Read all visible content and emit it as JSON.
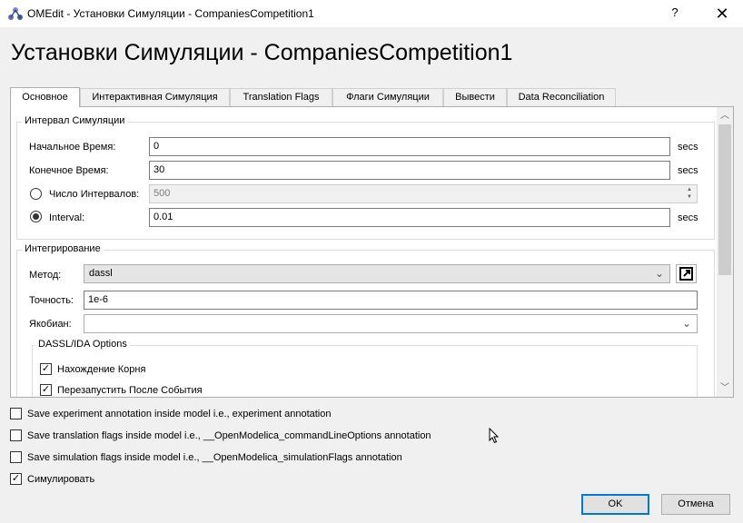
{
  "window": {
    "title": "OMEdit - Установки Симуляции - CompaniesCompetition1",
    "help": "?",
    "close": "✕"
  },
  "heading": "Установки Симуляции - CompaniesCompetition1",
  "tabs": [
    {
      "label": "Основное"
    },
    {
      "label": "Интерактивная Симуляция"
    },
    {
      "label": "Translation Flags"
    },
    {
      "label": "Флаги Симуляции"
    },
    {
      "label": "Вывести"
    },
    {
      "label": "Data Reconciliation"
    }
  ],
  "interval_group": {
    "title": "Интервал Симуляции",
    "start_label": "Начальное Время:",
    "start_value": "0",
    "stop_label": "Конечное Время:",
    "stop_value": "30",
    "num_intervals_label": "Число Интервалов:",
    "num_intervals_value": "500",
    "interval_label": "Interval:",
    "interval_value": "0.01",
    "unit": "secs"
  },
  "integration_group": {
    "title": "Интегрирование",
    "method_label": "Метод:",
    "method_value": "dassl",
    "tolerance_label": "Точность:",
    "tolerance_value": "1e-6",
    "jacobian_label": "Якобиан:",
    "jacobian_value": ""
  },
  "dassl_group": {
    "title": "DASSL/IDA Options",
    "root_finding": "Нахождение Корня",
    "restart_after_event": "Перезапустить После События"
  },
  "footer": {
    "save_experiment": "Save experiment annotation inside model i.e., experiment annotation",
    "save_translation": "Save translation flags inside model i.e., __OpenModelica_commandLineOptions annotation",
    "save_simulation": "Save simulation flags inside model i.e., __OpenModelica_simulationFlags annotation",
    "simulate": "Симулировать",
    "ok": "OK",
    "cancel": "Отмена"
  },
  "checks": {
    "checked_mark": "✓"
  },
  "colors": {
    "accent": "#0078d7"
  }
}
